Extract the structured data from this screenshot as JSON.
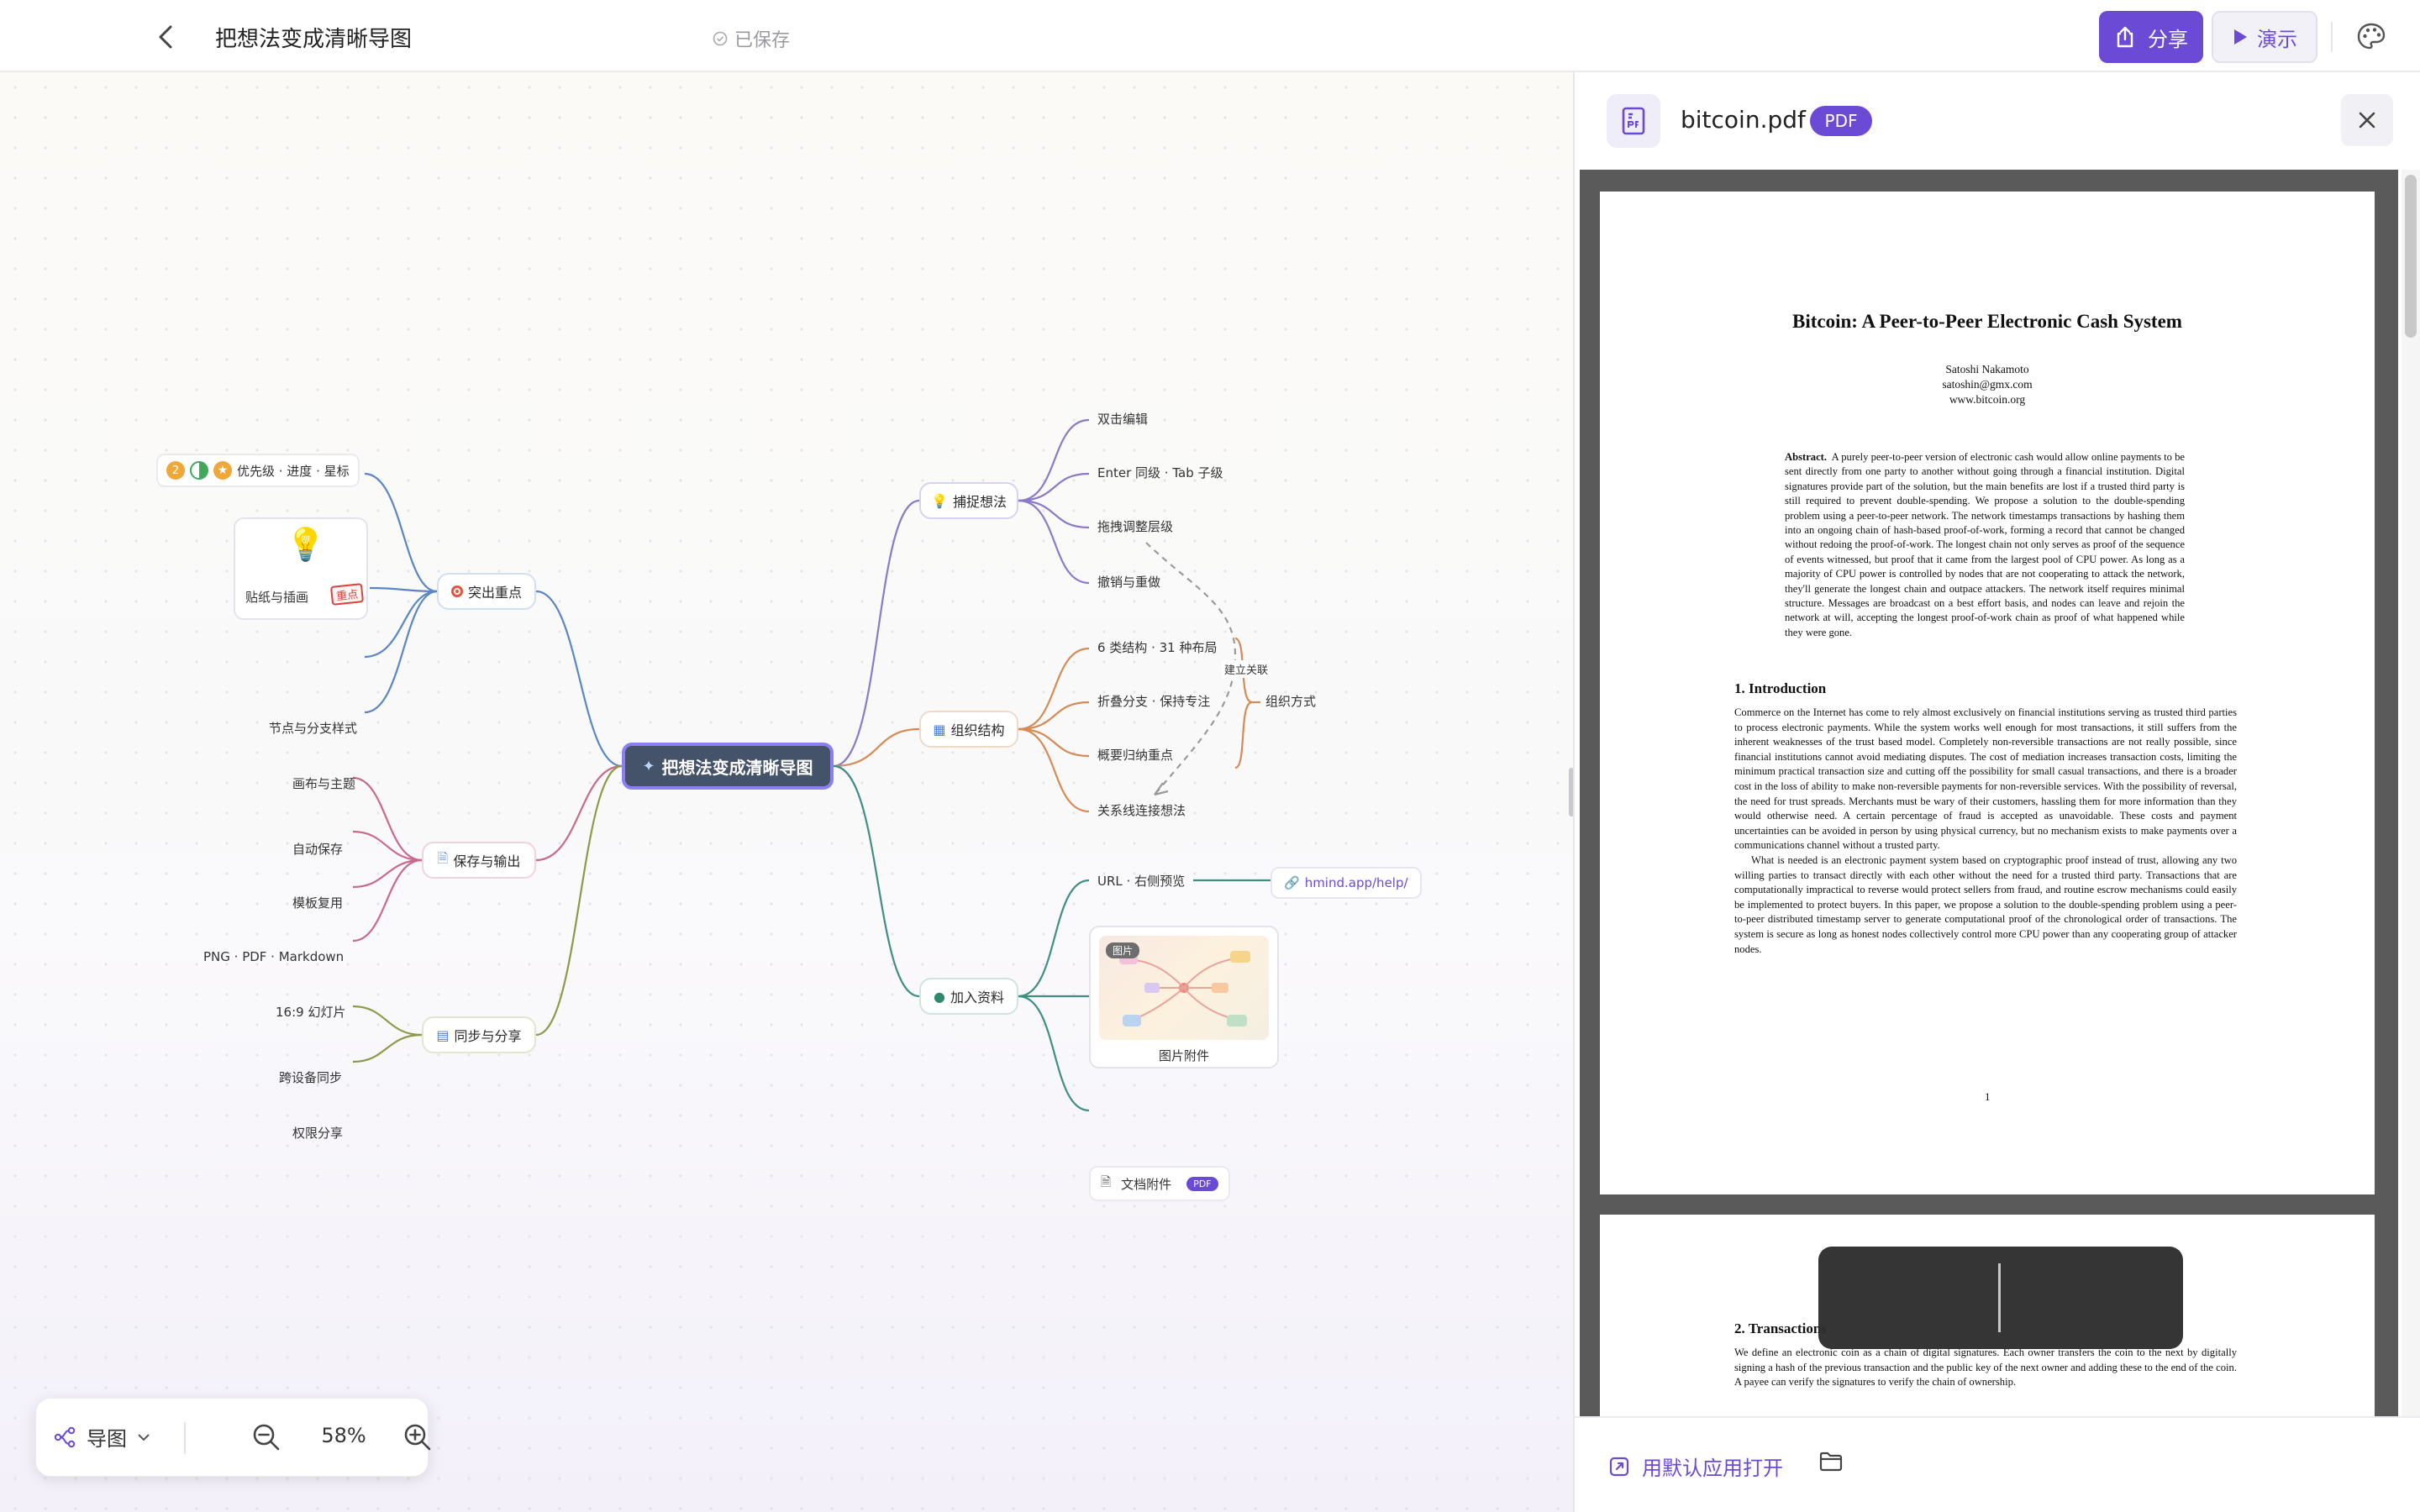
{
  "header": {
    "title": "把想法变成清晰导图",
    "saved_status": "已保存",
    "share_label": "分享",
    "present_label": "演示"
  },
  "mindmap": {
    "central": "把想法变成清晰导图",
    "branches": {
      "capture": {
        "label": "捕捉想法",
        "children": [
          "双击编辑",
          "Enter 同级 · Tab 子级",
          "拖拽调整层级",
          "撤销与重做"
        ]
      },
      "organize": {
        "label": "组织结构",
        "children": [
          "6 类结构 · 31 种布局",
          "折叠分支 · 保持专注",
          "概要归纳重点",
          "关系线连接想法"
        ],
        "summary": "组织方式",
        "relation": "建立关联"
      },
      "materials": {
        "label": "加入资料",
        "url_item": "URL · 右侧预览",
        "link_text": "hmind.app/help/",
        "image_tag": "图片",
        "image_caption": "图片附件",
        "doc_item": "文档附件",
        "doc_badge": "PDF"
      },
      "highlight": {
        "label": "突出重点",
        "markers_item": "优先级 · 进度 · 星标",
        "priority_number": "2",
        "sticker_item": "贴纸与插画",
        "sticker_tag": "重点",
        "style_item": "节点与分支样式",
        "theme_item": "画布与主题"
      },
      "save": {
        "label": "保存与输出",
        "children": [
          "自动保存",
          "模板复用",
          "PNG · PDF · Markdown",
          "16:9 幻灯片"
        ]
      },
      "sync": {
        "label": "同步与分享",
        "children": [
          "跨设备同步",
          "权限分享"
        ]
      }
    },
    "colors": {
      "capture": "#8a7ac8",
      "organize": "#d68a55",
      "materials": "#3f8f82",
      "highlight": "#5a86c4",
      "save": "#c96a8d",
      "sync": "#8e9a48"
    }
  },
  "zoom": {
    "mode": "导图",
    "level": "58%"
  },
  "panel": {
    "file_name": "bitcoin.pdf",
    "file_badge": "PDF",
    "open_default": "用默认应用打开",
    "pdf": {
      "title": "Bitcoin: A Peer-to-Peer Electronic Cash System",
      "author": "Satoshi Nakamoto",
      "email": "satoshin@gmx.com",
      "site": "www.bitcoin.org",
      "abstract_label": "Abstract.",
      "abstract": "A purely peer-to-peer version of electronic cash would allow online payments to be sent directly from one party to another without going through a financial institution. Digital signatures provide part of the solution, but the main benefits are lost if a trusted third party is still required to prevent double-spending. We propose a solution to the double-spending problem using a peer-to-peer network. The network timestamps transactions by hashing them into an ongoing chain of hash-based proof-of-work, forming a record that cannot be changed without redoing the proof-of-work. The longest chain not only serves as proof of the sequence of events witnessed, but proof that it came from the largest pool of CPU power. As long as a majority of CPU power is controlled by nodes that are not cooperating to attack the network, they'll generate the longest chain and outpace attackers. The network itself requires minimal structure. Messages are broadcast on a best effort basis, and nodes can leave and rejoin the network at will, accepting the longest proof-of-work chain as proof of what happened while they were gone.",
      "section1_heading": "1.     Introduction",
      "section1_p1": "Commerce on the Internet has come to rely almost exclusively on financial institutions serving as trusted third parties to process electronic payments. While the system works well enough for most transactions, it still suffers from the inherent weaknesses of the trust based model. Completely non-reversible transactions are not really possible, since financial institutions cannot avoid mediating disputes. The cost of mediation increases transaction costs, limiting the minimum practical transaction size and cutting off the possibility for small casual transactions, and there is a broader cost in the loss of ability to make non-reversible payments for non-reversible services. With the possibility of reversal, the need for trust spreads. Merchants must be wary of their customers, hassling them for more information than they would otherwise need. A certain percentage of fraud is accepted as unavoidable. These costs and payment uncertainties can be avoided in person by using physical currency, but no mechanism exists to make payments over a communications channel without a trusted party.",
      "section1_p2": "What is needed is an electronic payment system based on cryptographic proof instead of trust, allowing any two willing parties to transact directly with each other without the need for a trusted third party. Transactions that are computationally impractical to reverse would protect sellers from fraud, and routine escrow mechanisms could easily be implemented to protect buyers. In this paper, we propose a solution to the double-spending problem using a peer-to-peer distributed timestamp server to generate computational proof of the chronological order of transactions. The system is secure as long as honest nodes collectively control more CPU power than any cooperating group of attacker nodes.",
      "page_number": "1",
      "section2_heading": "2.     Transactions",
      "section2_p1": "We define an electronic coin as a chain of digital signatures. Each owner transfers the coin to the next by digitally signing a hash of the previous transaction and the public key of the next owner and adding these to the end of the coin. A payee can verify the signatures to verify the chain of ownership."
    }
  }
}
